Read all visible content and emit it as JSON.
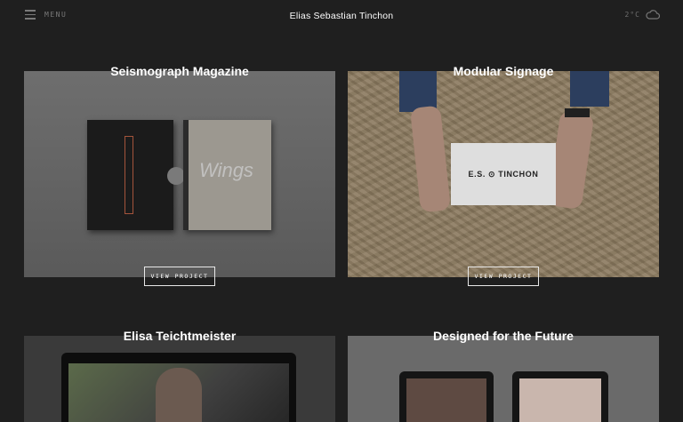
{
  "header": {
    "menu_label": "MENU",
    "site_title": "Elias Sebastian Tinchon",
    "temperature": "2°C",
    "weather_icon": "cloud-icon"
  },
  "projects": [
    {
      "title": "Seismograph Magazine",
      "cover_word": "Wings",
      "button_label": "VIEW PROJECT"
    },
    {
      "title": "Modular Signage",
      "sign_text": "E.S. ⊙ TINCHON",
      "button_label": "VIEW PROJECT"
    },
    {
      "title": "Elisa Teichtmeister"
    },
    {
      "title": "Designed for the Future"
    }
  ]
}
